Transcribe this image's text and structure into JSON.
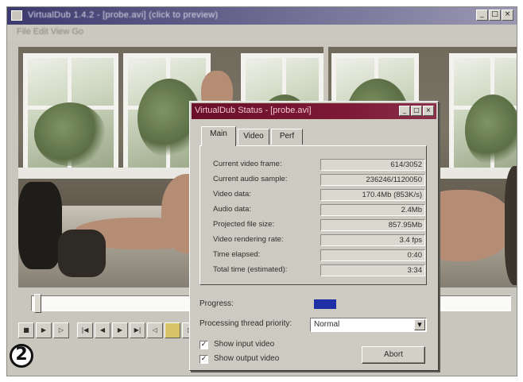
{
  "main_window": {
    "title": "VirtualDub 1.4.2 - [probe.avi] (click to preview)",
    "menu": "File  Edit  View  Go"
  },
  "toolbar": {
    "icons": [
      "stop-icon",
      "play-input-icon",
      "play-output-icon",
      "go-start-icon",
      "step-back-icon",
      "step-forward-icon",
      "go-end-icon",
      "key-previous-icon",
      "open-folder-icon",
      "key-next-icon"
    ]
  },
  "status_dialog": {
    "title": "VirtualDub Status - [probe.avi]",
    "tabs": [
      "Main",
      "Video",
      "Perf"
    ],
    "active_tab": "Main",
    "stats": [
      {
        "label": "Current video frame:",
        "value": "614/3052"
      },
      {
        "label": "Current audio sample:",
        "value": "236246/1120050"
      },
      {
        "label": "Video data:",
        "value": "170.4Mb (853K/s)"
      },
      {
        "label": "Audio data:",
        "value": "2.4Mb"
      },
      {
        "label": "Projected file size:",
        "value": "857.95Mb"
      },
      {
        "label": "Video rendering rate:",
        "value": "3.4 fps"
      },
      {
        "label": "Time elapsed:",
        "value": "0:40"
      },
      {
        "label": "Total time (estimated):",
        "value": "3:34"
      }
    ],
    "progress_label": "Progress:",
    "progress_fraction": 0.2,
    "priority_label": "Processing thread priority:",
    "priority_value": "Normal",
    "show_input_label": "Show input video",
    "show_input_checked": true,
    "show_output_label": "Show output video",
    "show_output_checked": true,
    "abort_label": "Abort"
  },
  "logo": {
    "glyph": "2"
  },
  "colors": {
    "dialog_title_bg": "#6a0f2a",
    "main_title_bg": "#3c3a6e",
    "progress_fill": "#1f2fa8",
    "window_face": "#c9c6bd"
  }
}
